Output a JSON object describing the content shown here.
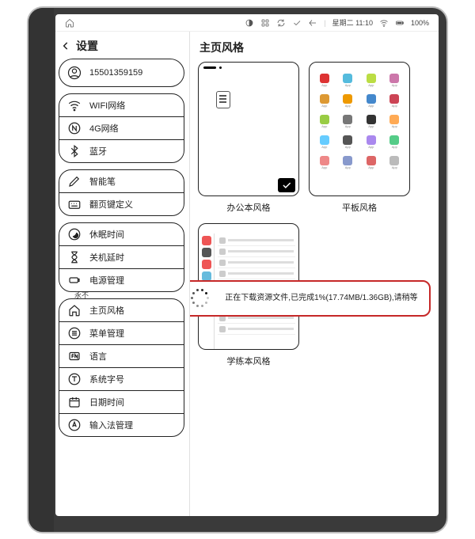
{
  "statusbar": {
    "day_time": "星期二 11:10",
    "battery": "100%"
  },
  "sidebar": {
    "title": "设置",
    "account": "15501359159",
    "groups": [
      [
        {
          "icon": "wifi-icon",
          "label": "WIFI网络"
        },
        {
          "icon": "cellular-icon",
          "label": "4G网络"
        },
        {
          "icon": "bluetooth-icon",
          "label": "蓝牙"
        }
      ],
      [
        {
          "icon": "pen-icon",
          "label": "智能笔"
        },
        {
          "icon": "keyboard-icon",
          "label": "翻页键定义"
        }
      ],
      [
        {
          "icon": "sleep-icon",
          "label": "休眠时间"
        },
        {
          "icon": "hourglass-icon",
          "label": "关机延时"
        },
        {
          "icon": "battery-icon",
          "label": "电源管理"
        }
      ],
      [
        {
          "icon": "home-icon",
          "label": "主页风格"
        },
        {
          "icon": "menu-icon",
          "label": "菜单管理"
        },
        {
          "icon": "language-icon",
          "label": "语言"
        },
        {
          "icon": "font-icon",
          "label": "系统字号"
        },
        {
          "icon": "calendar-icon",
          "label": "日期时间"
        },
        {
          "icon": "input-icon",
          "label": "输入法管理"
        }
      ]
    ],
    "truncated_label": "永不"
  },
  "main": {
    "title": "主页风格",
    "themes": [
      {
        "label": "办公本风格",
        "selected": true
      },
      {
        "label": "平板风格",
        "selected": false
      },
      {
        "label": "学练本风格",
        "selected": false
      }
    ]
  },
  "toast": {
    "message": "正在下载资源文件,已完成1%(17.74MB/1.36GB),请稍等"
  },
  "app_tiles": {
    "colors": [
      "#d33",
      "#5bd",
      "#bd4",
      "#c7a",
      "#d93",
      "#e90",
      "#48c",
      "#c45",
      "#9c4",
      "#777",
      "#333",
      "#fa5",
      "#6cf",
      "#555",
      "#a8e",
      "#5c8",
      "#e88",
      "#89c",
      "#d66",
      "#bbb"
    ],
    "left_colors": [
      "#e55",
      "#555",
      "#e55",
      "#6bd",
      "#88c",
      "#5bd"
    ]
  }
}
